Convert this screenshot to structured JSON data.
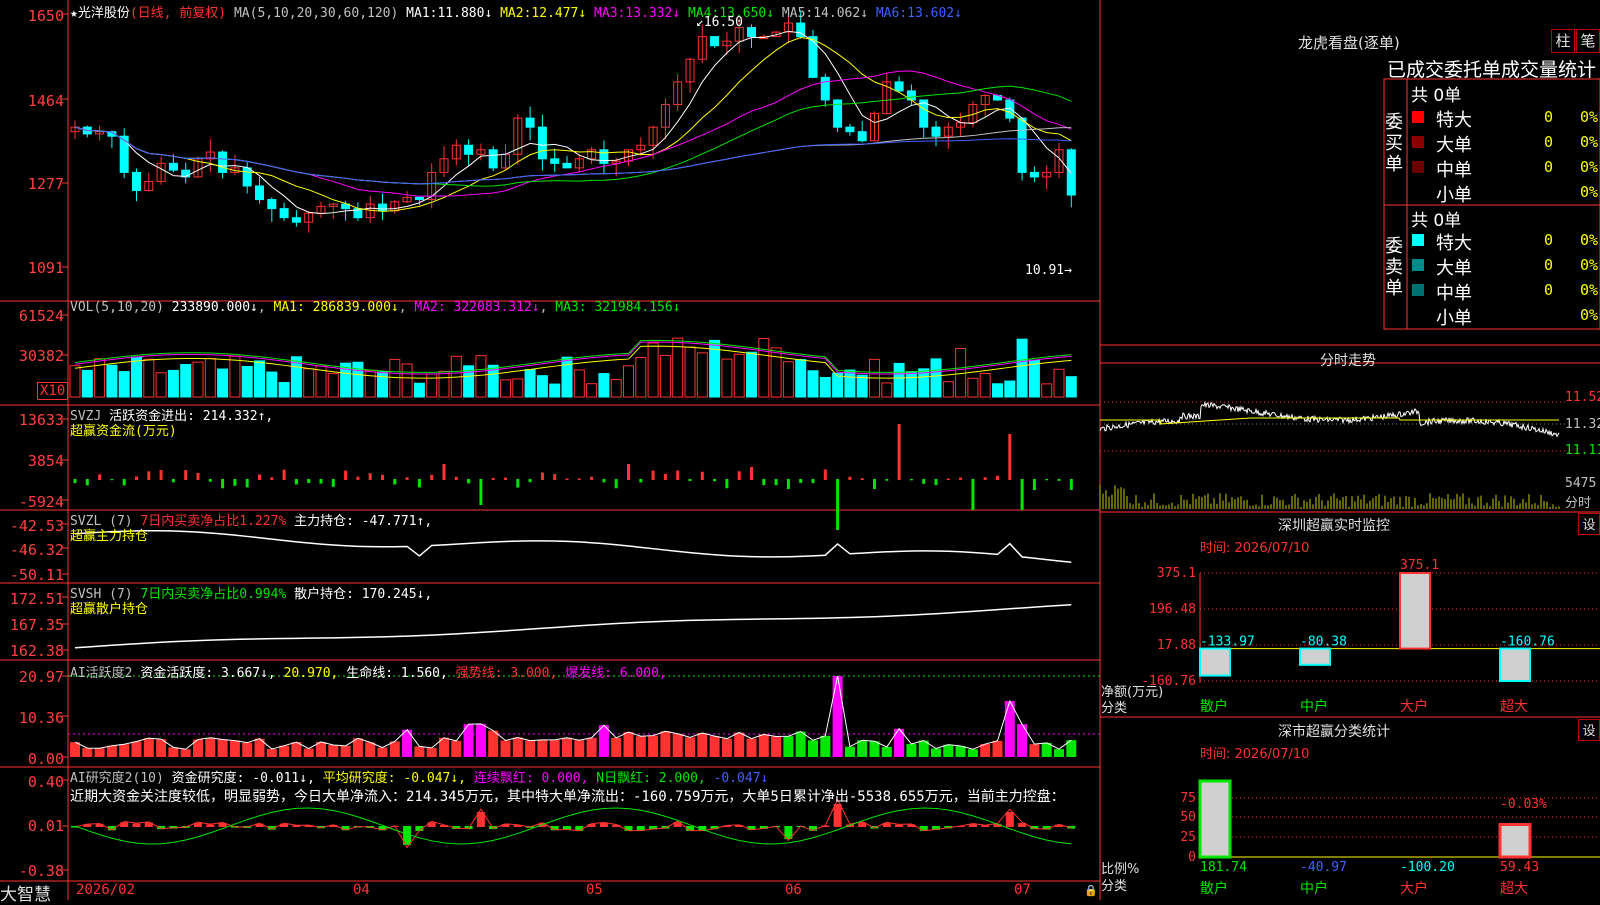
{
  "colors": {
    "red": "#ff3232",
    "cyan": "#00ffff",
    "green": "#00e600",
    "yellow": "#ffff00",
    "magenta": "#ff00ff",
    "white": "#ffffff",
    "blue": "#4060ff",
    "grid": "#b00000"
  },
  "header": {
    "stock_name": "★光洋股份",
    "mode": "(日线, 前复权)",
    "ma_params": "MA(5,10,20,30,60,120)",
    "ma": [
      {
        "label": "MA1:",
        "value": "11.880↓",
        "color": "#ffffff"
      },
      {
        "label": "MA2:",
        "value": "12.477↓",
        "color": "#ffff00"
      },
      {
        "label": "MA3:",
        "value": "13.332↓",
        "color": "#ff00ff"
      },
      {
        "label": "MA4:",
        "value": "13.650↓",
        "color": "#00e600"
      },
      {
        "label": "MA5:",
        "value": "14.062↓",
        "color": "#c0c0c0"
      },
      {
        "label": "MA6:",
        "value": "13.602↓",
        "color": "#4060ff"
      }
    ],
    "high_marker": "16.50",
    "low_marker": "10.91"
  },
  "price_axis": [
    "1650",
    "1464",
    "1277",
    "1091"
  ],
  "vol_panel": {
    "title": "VOL(5,10,20)",
    "value": "233890.000↓",
    "ma1": "MA1: 286839.000↓",
    "ma2": "MA2: 322083.312↓",
    "ma3": "MA3: 321984.156↓",
    "axis": [
      "61524",
      "30382"
    ],
    "unit": "X10"
  },
  "svzj_panel": {
    "title": "SVZJ",
    "text": "活跃资金进出: 214.332↑,",
    "sub": "超赢资金流(万元)",
    "axis": [
      "13633",
      "3854",
      "-5924"
    ]
  },
  "svzl_panel": {
    "title": "SVZL (7)",
    "ratio": "7日内买卖净占比1.227%",
    "text": "主力持仓: -47.771↑,",
    "sub": "超赢主力持仓",
    "axis": [
      "-42.53",
      "-46.32",
      "-50.11"
    ]
  },
  "svsh_panel": {
    "title": "SVSH (7)",
    "ratio": "7日内买卖净占比0.994%",
    "text": "散户持仓: 170.245↓,",
    "sub": "超赢散户持仓",
    "axis": [
      "172.51",
      "167.35",
      "162.38"
    ]
  },
  "ai_active": {
    "title": "AI活跃度2",
    "t1": "资金活跃度: 3.667↓,",
    "t2": "20.970,",
    "t3": "生命线: 1.560,",
    "t4": "强势线: 3.000,",
    "t5": "爆发线: 6.000,",
    "axis": [
      "20.97",
      "10.36",
      "0.00"
    ]
  },
  "ai_research": {
    "title": "AI研究度2(10)",
    "t1": "资金研究度: -0.011↓,",
    "t2": "平均研究度: -0.047↓,",
    "t3": "连续飘红: 0.000,",
    "t4": "N日飘红: 2.000,",
    "t5": "-0.047↓",
    "comment": "近期大资金关注度较低，明显弱势，今日大单净流入：214.345万元，其中特大单净流出：-160.759万元，大单5日累计净出-5538.655万元，当前主力控盘：",
    "axis": [
      "0.40",
      "0.01",
      "-0.38"
    ]
  },
  "bottom_bar": {
    "brand": "大智慧",
    "dates": [
      "2026/02",
      "04",
      "05",
      "06",
      "07"
    ]
  },
  "lhb": {
    "title": "龙虎看盘(逐单)",
    "btn1": "柱",
    "btn2": "笔",
    "header": "已成交委托单成交量统计",
    "buy_side": "委买单",
    "buy_total": "共 0单",
    "buy_rows": [
      {
        "label": "特大",
        "count": "0",
        "pct": "0%",
        "color": "#ff0000"
      },
      {
        "label": "大单",
        "count": "0",
        "pct": "0%",
        "color": "#8b0000"
      },
      {
        "label": "中单",
        "count": "0",
        "pct": "0%",
        "color": "#6b0000"
      },
      {
        "label": "小单",
        "count": "0",
        "pct": "0%",
        "color": ""
      }
    ],
    "sell_side": "委卖单",
    "sell_total": "共 0单",
    "sell_rows": [
      {
        "label": "特大",
        "count": "0",
        "pct": "0%",
        "color": "#00ffff"
      },
      {
        "label": "大单",
        "count": "0",
        "pct": "0%",
        "color": "#008b8b"
      },
      {
        "label": "中单",
        "count": "0",
        "pct": "0%",
        "color": "#007070"
      },
      {
        "label": "小单",
        "count": "0",
        "pct": "0%",
        "color": ""
      }
    ]
  },
  "intraday": {
    "title": "分时走势",
    "axis": [
      "11.52",
      "11.32",
      "11.11"
    ],
    "vol_label": "5475",
    "vol_unit": "分时"
  },
  "monitor": {
    "title": "深圳超赢实时监控",
    "btn": "设",
    "time": "时间: 2026/07/10",
    "ylab": "净额(万元)",
    "xlab": "分类",
    "axis": [
      "375.1",
      "196.48",
      "17.88",
      "-160.76"
    ],
    "chart_data": {
      "type": "bar",
      "categories": [
        "散户",
        "中户",
        "大户",
        "超大"
      ],
      "values": [
        -133.97,
        -80.38,
        375.1,
        -160.76
      ],
      "labels": [
        "-133.97",
        "-80.38",
        "375.1",
        "-160.76"
      ],
      "ylim": [
        -160.76,
        375.1
      ]
    }
  },
  "classify": {
    "title": "深市超赢分类统计",
    "btn": "设",
    "time": "时间: 2026/07/10",
    "ylab": "比例%",
    "xlab": "分类",
    "axis": [
      "75",
      "50",
      "25",
      "0"
    ],
    "chart_data": {
      "type": "bar",
      "categories": [
        "散户",
        "中户",
        "大户",
        "超大"
      ],
      "values": [
        181.74,
        -40.97,
        -100.2,
        59.43
      ],
      "labels": [
        "181.74",
        "-40.97",
        "-100.20",
        "59.43"
      ],
      "top_label": "-0.03%",
      "ylim": [
        0,
        75
      ]
    }
  }
}
